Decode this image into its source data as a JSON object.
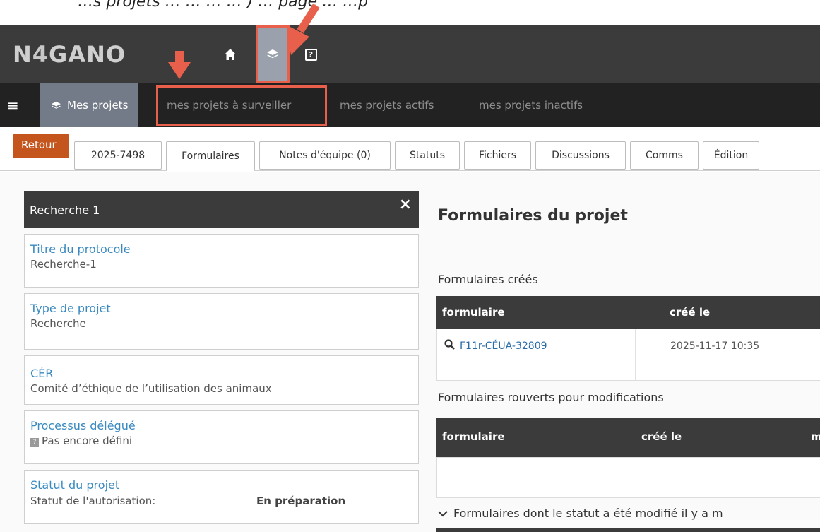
{
  "top_strip_text": "…s projets … … … … ) … page … …p",
  "brand": {
    "logo_prefix": "N",
    "logo_four": "4",
    "logo_suffix": "GANO"
  },
  "topnav": {
    "help_label": "?"
  },
  "navbar": {
    "mes_projets": "Mes projets",
    "links": [
      "mes projets à surveiller",
      "mes projets actifs",
      "mes projets inactifs"
    ]
  },
  "tabs": {
    "retour": "Retour",
    "items": [
      "2025-7498",
      "Formulaires",
      "Notes d'équipe (0)",
      "Statuts",
      "Fichiers",
      "Discussions",
      "Comms",
      "Édition"
    ],
    "active": "Formulaires"
  },
  "left_panel": {
    "header": "Recherche 1",
    "close": "×",
    "cards": [
      {
        "title": "Titre du protocole",
        "value": "Recherche-1"
      },
      {
        "title": "Type de projet",
        "value": "Recherche"
      },
      {
        "title": "CÉR",
        "value": "Comité d’éthique de l’utilisation des animaux"
      },
      {
        "title": "Processus délégué",
        "value": "Pas encore défini",
        "badge": "?"
      },
      {
        "title": "Statut du projet",
        "status_label": "Statut de l'autorisation:",
        "status_value": "En préparation"
      }
    ]
  },
  "main": {
    "title": "Formulaires du projet",
    "created_section": "Formulaires créés",
    "created_table": {
      "headers": [
        "formulaire",
        "créé le"
      ],
      "rows": [
        {
          "form": "F11r-CÉUA-32809",
          "date": "2025-11-17 10:35"
        }
      ]
    },
    "reopened_section": "Formulaires rouverts pour modifications",
    "reopened_table": {
      "headers": [
        "formulaire",
        "créé le",
        "mis"
      ]
    },
    "modified_section": "Formulaires dont le statut a été modifié il y a m"
  },
  "colors": {
    "accent_red": "#e8604c",
    "retour_orange": "#c4551c",
    "link_blue": "#3a8ac0",
    "dark_header": "#3b3b3b"
  }
}
